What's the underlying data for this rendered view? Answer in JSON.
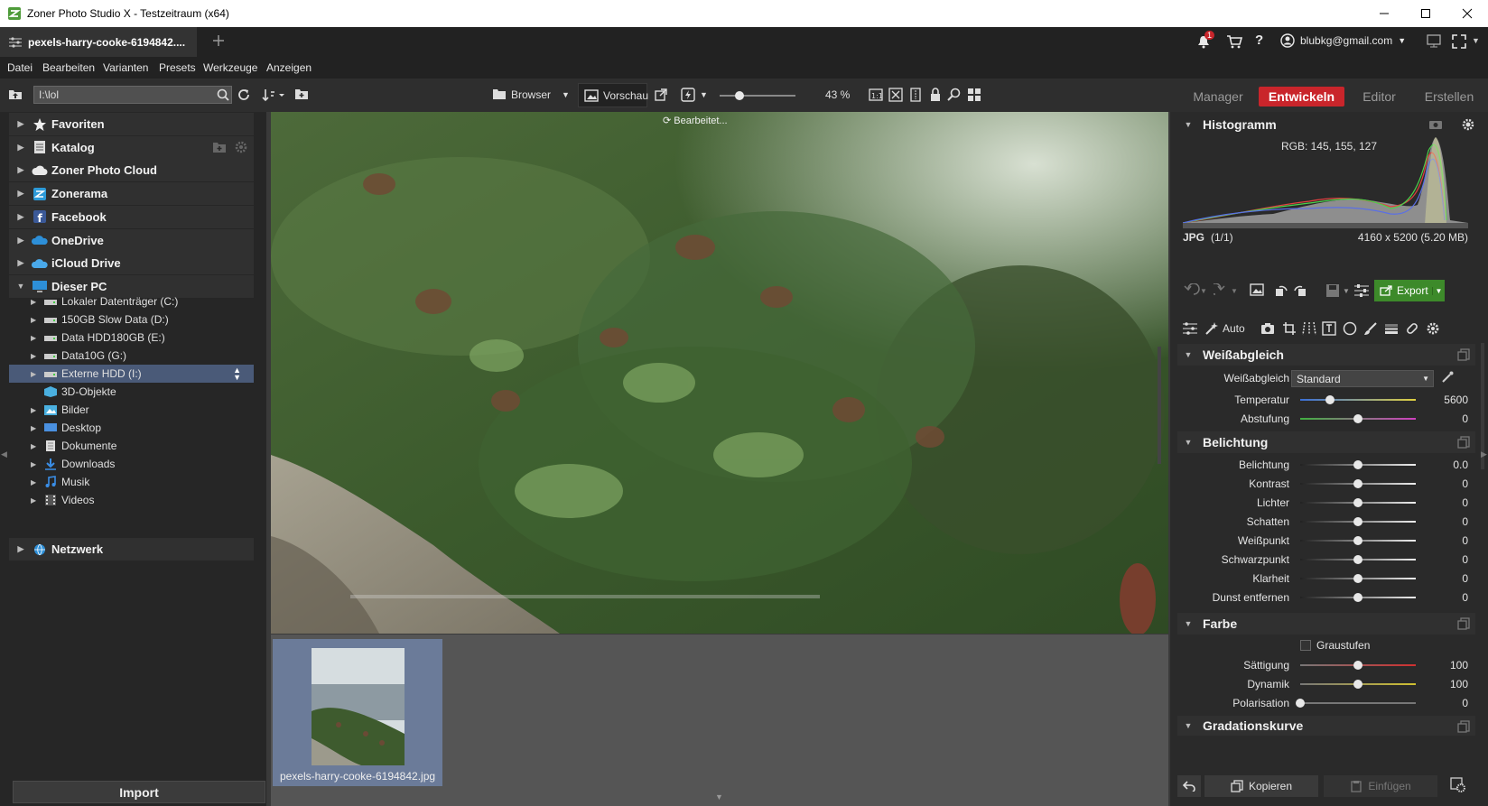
{
  "window": {
    "title": "Zoner Photo Studio X - Testzeitraum (x64)"
  },
  "tabbar": {
    "doc_tab": "pexels-harry-cooke-6194842....",
    "notification_count": "1",
    "account": "blubkg@gmail.com"
  },
  "menu": [
    "Datei",
    "Bearbeiten",
    "Varianten",
    "Presets",
    "Werkzeuge",
    "Anzeigen"
  ],
  "toolbar": {
    "path": "I:\\lol",
    "browser": "Browser",
    "preview": "Vorschau",
    "zoom": "43 %",
    "zoom_level": 0.43,
    "modules": [
      "Manager",
      "Entwickeln",
      "Editor",
      "Erstellen"
    ],
    "active_module": "Entwickeln"
  },
  "nav": {
    "top": [
      {
        "label": "Favoriten",
        "icon": "star-icon"
      },
      {
        "label": "Katalog",
        "icon": "catalog-icon"
      },
      {
        "label": "Zoner Photo Cloud",
        "icon": "cloud-icon"
      },
      {
        "label": "Zonerama",
        "icon": "zonerama-icon"
      },
      {
        "label": "Facebook",
        "icon": "facebook-icon"
      },
      {
        "label": "OneDrive",
        "icon": "onedrive-icon"
      },
      {
        "label": "iCloud Drive",
        "icon": "icloud-icon"
      },
      {
        "label": "Dieser PC",
        "icon": "computer-icon"
      }
    ],
    "pc_items": [
      {
        "label": "Lokaler Datenträger (C:)",
        "icon": "drive-icon"
      },
      {
        "label": "150GB Slow Data (D:)",
        "icon": "drive-icon"
      },
      {
        "label": "Data HDD180GB (E:)",
        "icon": "drive-icon"
      },
      {
        "label": "Data10G (G:)",
        "icon": "drive-icon"
      },
      {
        "label": "Externe HDD (I:)",
        "icon": "drive-icon",
        "selected": true
      },
      {
        "label": "3D-Objekte",
        "icon": "3d-objects-icon"
      },
      {
        "label": "Bilder",
        "icon": "pictures-folder-icon"
      },
      {
        "label": "Desktop",
        "icon": "desktop-folder-icon"
      },
      {
        "label": "Dokumente",
        "icon": "documents-folder-icon"
      },
      {
        "label": "Downloads",
        "icon": "downloads-folder-icon"
      },
      {
        "label": "Musik",
        "icon": "music-folder-icon"
      },
      {
        "label": "Videos",
        "icon": "videos-folder-icon"
      }
    ],
    "network": "Netzwerk",
    "import": "Import"
  },
  "preview": {
    "status": "Bearbeitet..."
  },
  "filmstrip": {
    "filename": "pexels-harry-cooke-6194842.jpg"
  },
  "histogram": {
    "title": "Histogramm",
    "rgb": "RGB: 145, 155, 127",
    "format": "JPG",
    "index": "(1/1)",
    "dims": "4160 x 5200 (5.20 MB)"
  },
  "actions": {
    "export": "Export",
    "auto": "Auto"
  },
  "whitebalance": {
    "title": "Weißabgleich",
    "label": "Weißabgleich",
    "preset": "Standard",
    "sliders": [
      {
        "label": "Temperatur",
        "value": "5600",
        "pos": 0.26
      },
      {
        "label": "Abstufung",
        "value": "0",
        "pos": 0.5
      }
    ]
  },
  "exposure": {
    "title": "Belichtung",
    "sliders": [
      {
        "label": "Belichtung",
        "value": "0.0",
        "pos": 0.5
      },
      {
        "label": "Kontrast",
        "value": "0",
        "pos": 0.5
      },
      {
        "label": "Lichter",
        "value": "0",
        "pos": 0.5
      },
      {
        "label": "Schatten",
        "value": "0",
        "pos": 0.5
      },
      {
        "label": "Weißpunkt",
        "value": "0",
        "pos": 0.5
      },
      {
        "label": "Schwarzpunkt",
        "value": "0",
        "pos": 0.5
      },
      {
        "label": "Klarheit",
        "value": "0",
        "pos": 0.5
      },
      {
        "label": "Dunst entfernen",
        "value": "0",
        "pos": 0.5
      }
    ]
  },
  "color": {
    "title": "Farbe",
    "grayscale": "Graustufen",
    "sliders": [
      {
        "label": "Sättigung",
        "value": "100",
        "pos": 0.5
      },
      {
        "label": "Dynamik",
        "value": "100",
        "pos": 0.5
      },
      {
        "label": "Polarisation",
        "value": "0",
        "pos": 0.0
      }
    ]
  },
  "curves": {
    "title": "Gradationskurve"
  },
  "bottom": {
    "copy": "Kopieren",
    "paste": "Einfügen"
  },
  "colors": {
    "accent": "#c9252b",
    "export_green": "#3d8a2a",
    "selection": "#4a5a78"
  }
}
